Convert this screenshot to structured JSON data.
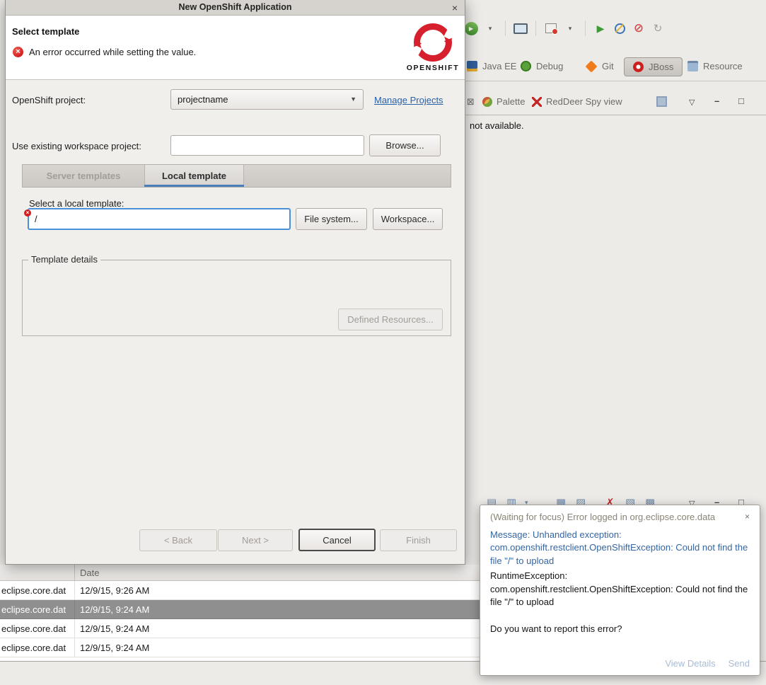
{
  "colors": {
    "brand_red": "#d6202d",
    "error_red": "#d21e1e",
    "link_blue": "#2961a8",
    "focus_blue": "#4a90d9",
    "message_blue": "#3465a4",
    "selection_gray": "#8f8f8f"
  },
  "icons": {
    "dialog_close": "×",
    "combo_arrow": "▼",
    "dropdown": "▾",
    "view_menu": "▽",
    "minimize": "–",
    "maximize": "□",
    "tab_close": "⊠",
    "run": "▶",
    "terminate": "⊘",
    "relaunch": "↻",
    "clear_log": "✗",
    "log_icon_1": "▤",
    "log_icon_2": "▥",
    "log_icon_3": "▦",
    "log_icon_4": "▨",
    "log_icon_5": "▧",
    "log_icon_6": "▩",
    "notification_close": "×"
  },
  "dialog": {
    "title": "New OpenShift Application",
    "header": {
      "title": "Select template",
      "error_message": "An error occurred while setting the value.",
      "brand": "OPENSHIFT"
    },
    "form": {
      "project_label": "OpenShift project:",
      "project_value": "projectname",
      "manage_projects_link": "Manage Projects",
      "existing_project_label": "Use existing workspace project:",
      "existing_project_value": "",
      "browse_button": "Browse...",
      "tab_server": "Server templates",
      "tab_local": "Local template",
      "local_template_label": "Select a local template:",
      "local_template_value": "/",
      "file_system_button": "File system...",
      "workspace_button": "Workspace...",
      "details_group_label": "Template details",
      "defined_resources_button": "Defined Resources..."
    },
    "footer": {
      "back_button": "< Back",
      "next_button": "Next >",
      "cancel_button": "Cancel",
      "finish_button": "Finish"
    }
  },
  "ide": {
    "perspective_bar": {
      "items": [
        "Java EE",
        "Debug",
        "Git",
        "JBoss",
        "Resource"
      ],
      "active": "JBoss"
    },
    "view_tabs": {
      "palette": "Palette",
      "reddeer": "RedDeer Spy view"
    },
    "view_message": "not available."
  },
  "log_table": {
    "date_column": "Date",
    "selected_index": 1,
    "rows": [
      {
        "plugin": "eclipse.core.dat",
        "date": "12/9/15, 9:26 AM"
      },
      {
        "plugin": "eclipse.core.dat",
        "date": "12/9/15, 9:24 AM"
      },
      {
        "plugin": "eclipse.core.dat",
        "date": "12/9/15, 9:24 AM"
      },
      {
        "plugin": "eclipse.core.dat",
        "date": "12/9/15, 9:24 AM"
      }
    ]
  },
  "notification": {
    "title": "(Waiting for focus) Error logged in org.eclipse.core.data",
    "message": "Message: Unhandled exception: com.openshift.restclient.OpenShiftException: Could not find the file \"/\" to upload",
    "detail": "RuntimeException: com.openshift.restclient.OpenShiftException: Could not find the file \"/\" to upload",
    "question": "Do you want to report this error?",
    "view_details_link": "View Details",
    "send_link": "Send"
  }
}
